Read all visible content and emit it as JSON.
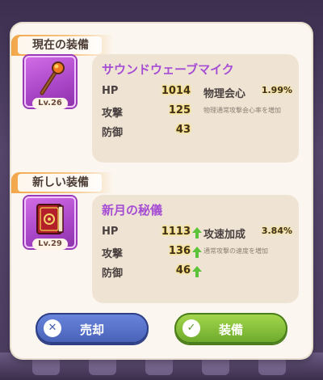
{
  "colors": {
    "accent_purple": "#a64ed3",
    "label_orange": "#f2a64a",
    "sell_blue": "#4761b6",
    "equip_green": "#6ca92b",
    "value_glow": "#ffe04a"
  },
  "current": {
    "section_label": "現在の装備",
    "icon": "microphone-staff-icon",
    "level": "Lv.26",
    "name": "サウンドウェーブマイク",
    "stats": [
      {
        "label": "HP",
        "value": "1014",
        "increased": false
      },
      {
        "label": "攻撃",
        "value": "125",
        "increased": false
      },
      {
        "label": "防御",
        "value": "43",
        "increased": false
      }
    ],
    "effect": {
      "name": "物理会心",
      "value": "1.99%",
      "desc": "物理通常攻撃会心率を増加"
    }
  },
  "new": {
    "section_label": "新しい装備",
    "icon": "red-book-icon",
    "level": "Lv.29",
    "name": "新月の秘儀",
    "stats": [
      {
        "label": "HP",
        "value": "1113",
        "increased": true
      },
      {
        "label": "攻撃",
        "value": "136",
        "increased": true
      },
      {
        "label": "防御",
        "value": "46",
        "increased": true
      }
    ],
    "effect": {
      "name": "攻速加成",
      "value": "3.84%",
      "desc": "通常攻撃の速度を増加"
    }
  },
  "buttons": {
    "sell": {
      "label": "売却",
      "icon": "close-icon"
    },
    "equip": {
      "label": "装備",
      "icon": "check-icon"
    }
  }
}
